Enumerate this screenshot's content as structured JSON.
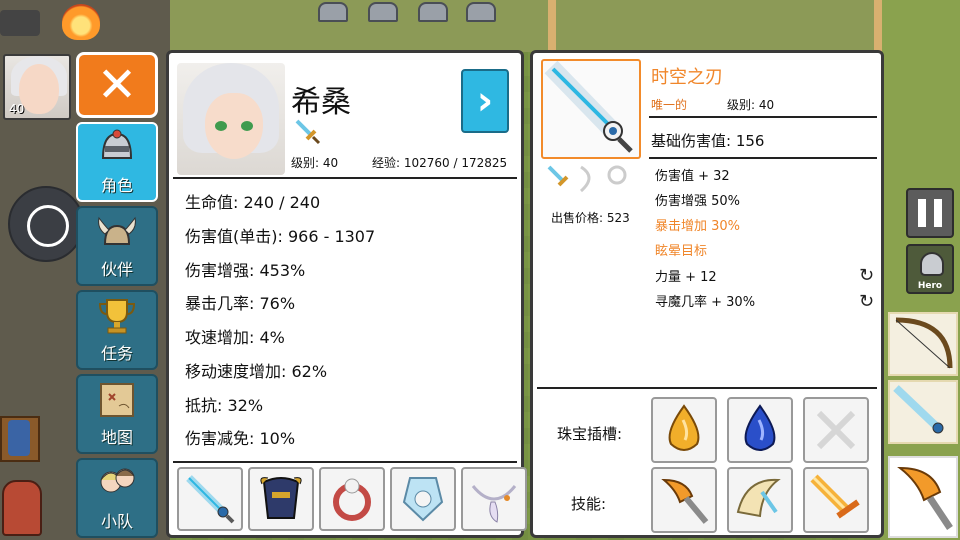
{
  "hero_badge": {
    "level": "40"
  },
  "menu": {
    "items": [
      {
        "id": "character",
        "label": "角色",
        "active": true
      },
      {
        "id": "partner",
        "label": "伙伴",
        "active": false
      },
      {
        "id": "quest",
        "label": "任务",
        "active": false
      },
      {
        "id": "map",
        "label": "地图",
        "active": false
      },
      {
        "id": "team",
        "label": "小队",
        "active": false
      }
    ]
  },
  "character": {
    "name": "希桑",
    "level_text": "级别: 40",
    "exp_text": "经验: 102760 / 172825",
    "stats": [
      "生命值: 240 / 240",
      "伤害值(单击): 966 - 1307",
      "伤害增强: 453%",
      "暴击几率: 76%",
      "攻速增加: 4%",
      "移动速度增加: 62%",
      "抵抗: 32%",
      "伤害减免: 10%"
    ]
  },
  "item": {
    "name": "时空之刃",
    "rarity": "唯一的",
    "level_text": "级别: 40",
    "base_damage": "基础伤害值: 156",
    "sell_price": "出售价格: 523",
    "affixes": [
      {
        "text": "伤害值 + 32",
        "highlight": false,
        "reroll": false
      },
      {
        "text": "伤害增强 50%",
        "highlight": false,
        "reroll": false
      },
      {
        "text": "暴击增加 30%",
        "highlight": true,
        "reroll": false
      },
      {
        "text": "眩晕目标",
        "highlight": true,
        "reroll": false
      },
      {
        "text": "力量 + 12",
        "highlight": false,
        "reroll": true
      },
      {
        "text": "寻魔几率 + 30%",
        "highlight": false,
        "reroll": true
      }
    ],
    "gem_label": "珠宝插槽:",
    "skill_label": "技能:"
  },
  "hud": {
    "hero_button_label": "Hero"
  },
  "colors": {
    "accent_blue": "#2fb8e2",
    "close_orange": "#f17b1c",
    "item_orange": "#f0862a"
  }
}
